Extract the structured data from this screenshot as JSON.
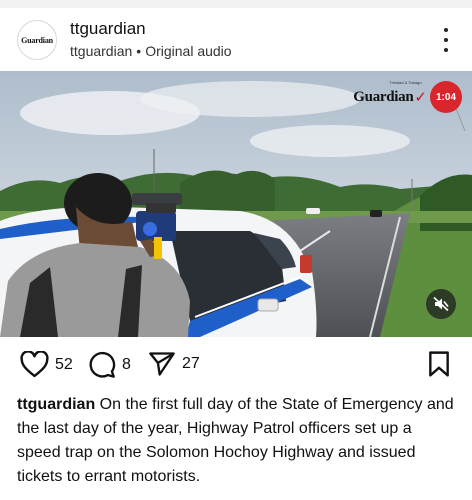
{
  "post": {
    "account": {
      "avatar_text": "Guardian",
      "username": "ttguardian",
      "subtitle_user": "ttguardian",
      "separator": "•",
      "audio": "Original audio"
    },
    "media": {
      "watermark_small": "Trinidad & Tobago",
      "watermark": "Guardian",
      "watermark_check": "✓",
      "watermark_badge": "1:04"
    },
    "actions": {
      "likes": "52",
      "comments": "8",
      "shares": "27"
    },
    "caption": {
      "username": "ttguardian",
      "text": "On the first full day of the State of Emergency and the last day of the year, Highway Patrol officers set up a speed trap on the Solomon Hochoy Highway and issued tickets to errant motorists."
    }
  },
  "icons": {
    "more": "more-vertical-icon",
    "like": "heart-icon",
    "comment": "comment-bubble-icon",
    "share": "send-icon",
    "save": "bookmark-icon",
    "mute": "speaker-muted-icon"
  },
  "colors": {
    "badge": "#d8262c",
    "police_stripe": "#1f5fc9"
  }
}
